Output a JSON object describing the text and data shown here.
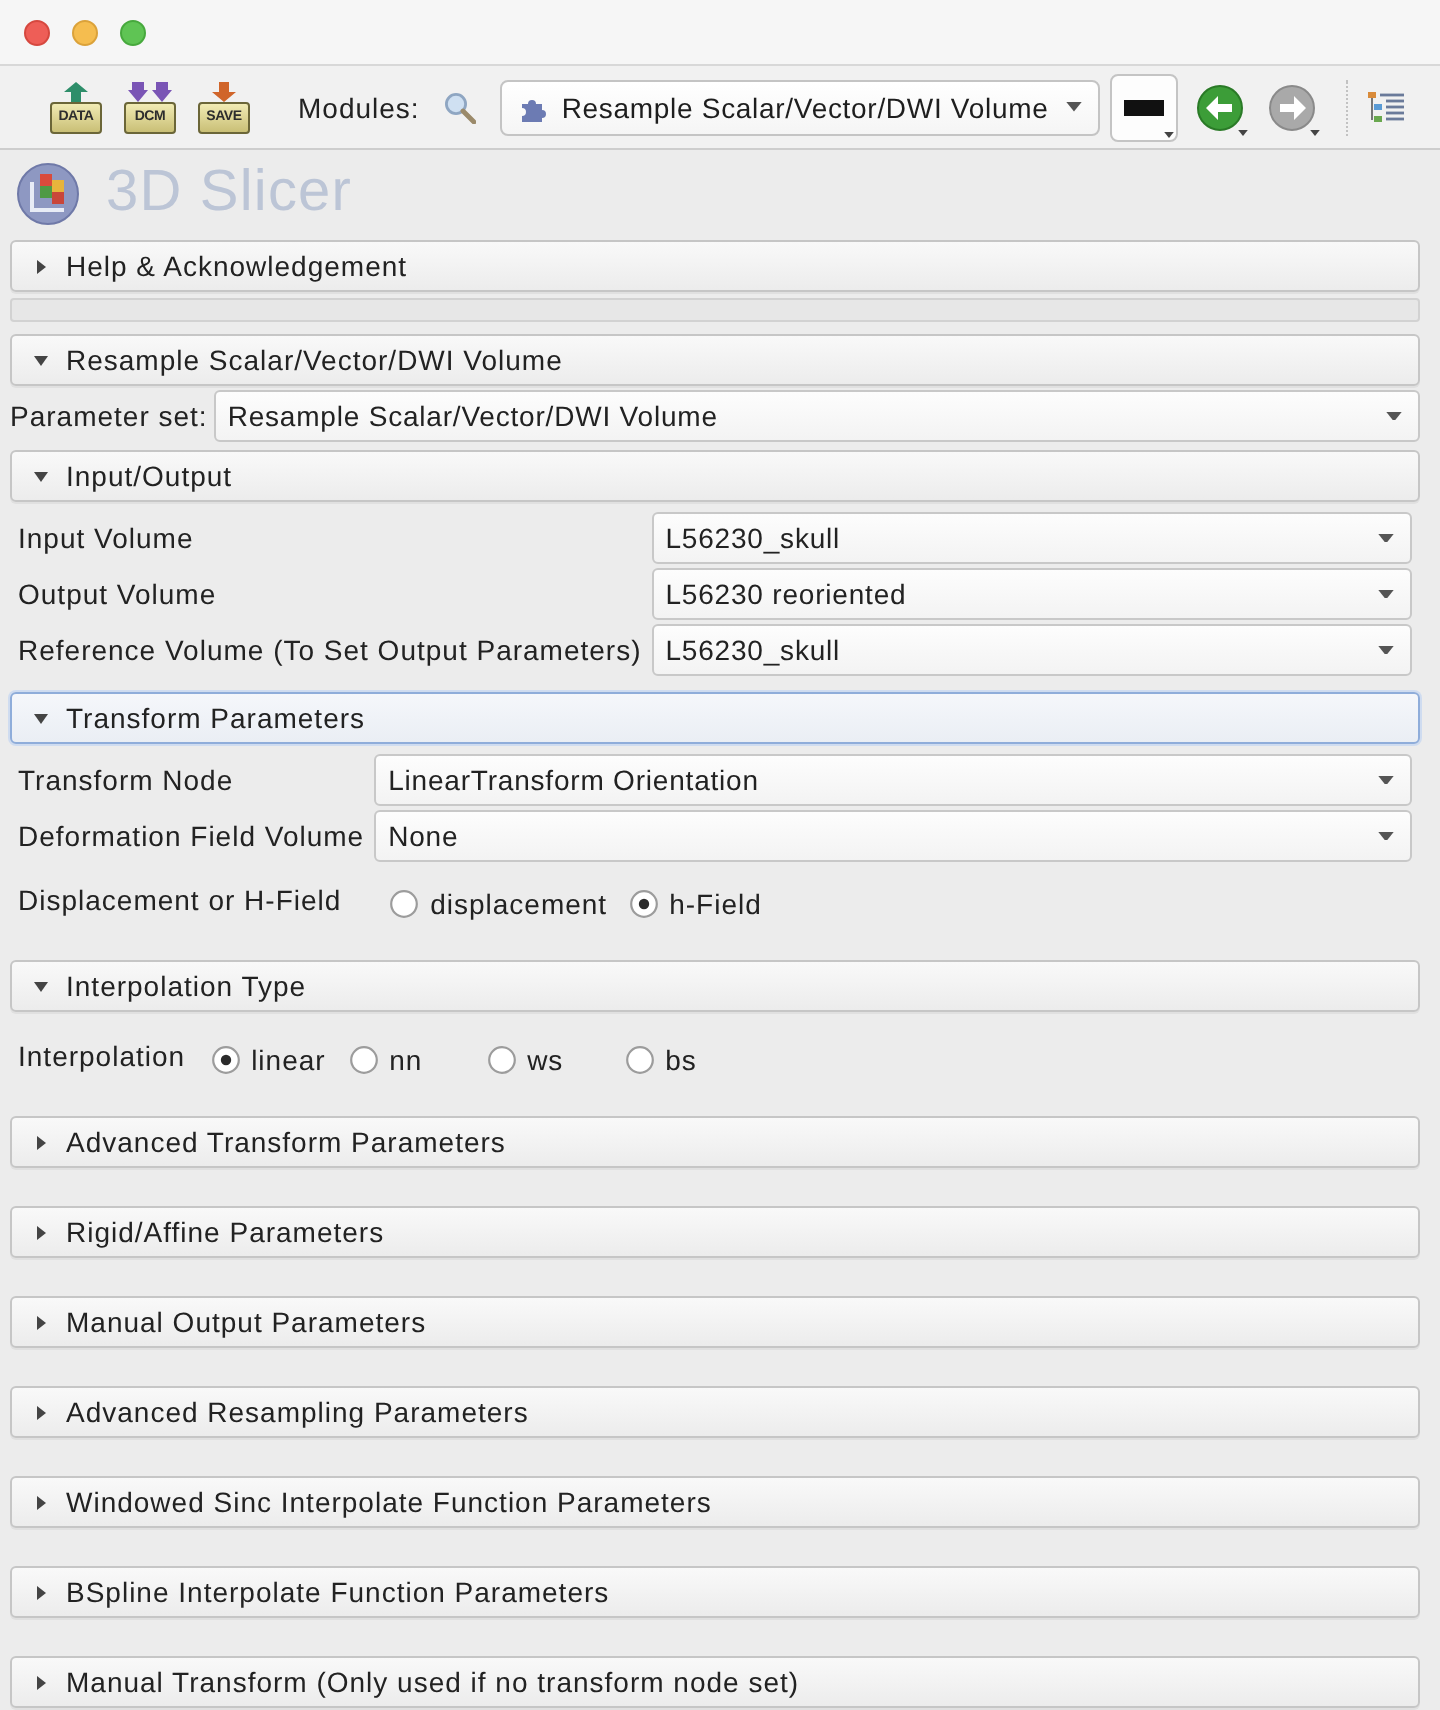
{
  "toolbar": {
    "file_buttons": [
      {
        "kind": "load",
        "label": "DATA"
      },
      {
        "kind": "dicom",
        "label": "DCM"
      },
      {
        "kind": "save",
        "label": "SAVE"
      }
    ],
    "modules_label": "Modules:",
    "module_selector": {
      "value": "Resample Scalar/Vector/DWI Volume"
    },
    "navigation": [
      {
        "kind": "back",
        "disabled": false
      },
      {
        "kind": "forward",
        "disabled": true
      }
    ]
  },
  "logo": {
    "text": "3D Slicer"
  },
  "panels": [
    {
      "title": "Help & Acknowledgement",
      "expanded": false,
      "focused": false
    },
    {
      "title": "Resample Scalar/Vector/DWI Volume",
      "expanded": true,
      "focused": false,
      "parameter_set": {
        "label": "Parameter set:",
        "value": "Resample Scalar/Vector/DWI Volume"
      },
      "sections": [
        {
          "title": "Input/Output",
          "expanded": true,
          "focused": false,
          "rows": [
            {
              "kind": "combo",
              "label": "Input Volume",
              "value": "L56230_skull"
            },
            {
              "kind": "combo",
              "label": "Output Volume",
              "value": "L56230 reoriented"
            },
            {
              "kind": "combo",
              "label": "Reference Volume (To Set Output Parameters)",
              "value": "L56230_skull"
            }
          ]
        },
        {
          "title": "Transform Parameters",
          "expanded": true,
          "focused": true,
          "rows": [
            {
              "kind": "combo",
              "label": "Transform Node",
              "value": "LinearTransform Orientation"
            },
            {
              "kind": "combo",
              "label": "Deformation Field Volume",
              "value": "None"
            },
            {
              "kind": "radio",
              "label": "Displacement or H-Field",
              "options": [
                {
                  "label": "displacement",
                  "selected": false
                },
                {
                  "label": "h-Field",
                  "selected": true
                }
              ]
            }
          ]
        },
        {
          "title": "Interpolation Type",
          "expanded": true,
          "focused": false,
          "rows": [
            {
              "kind": "radio",
              "label": "Interpolation",
              "options": [
                {
                  "label": "linear",
                  "selected": true
                },
                {
                  "label": "nn",
                  "selected": false
                },
                {
                  "label": "ws",
                  "selected": false
                },
                {
                  "label": "bs",
                  "selected": false
                }
              ]
            }
          ]
        },
        {
          "title": "Advanced Transform Parameters",
          "expanded": false,
          "focused": false
        },
        {
          "title": "Rigid/Affine Parameters",
          "expanded": false,
          "focused": false
        },
        {
          "title": "Manual Output Parameters",
          "expanded": false,
          "focused": false
        },
        {
          "title": "Advanced Resampling Parameters",
          "expanded": false,
          "focused": false
        },
        {
          "title": "Windowed Sinc Interpolate Function Parameters",
          "expanded": false,
          "focused": false
        },
        {
          "title": "BSpline Interpolate Function Parameters",
          "expanded": false,
          "focused": false
        },
        {
          "title": "Manual Transform (Only used if no transform node set)",
          "expanded": false,
          "focused": false
        }
      ]
    }
  ]
}
